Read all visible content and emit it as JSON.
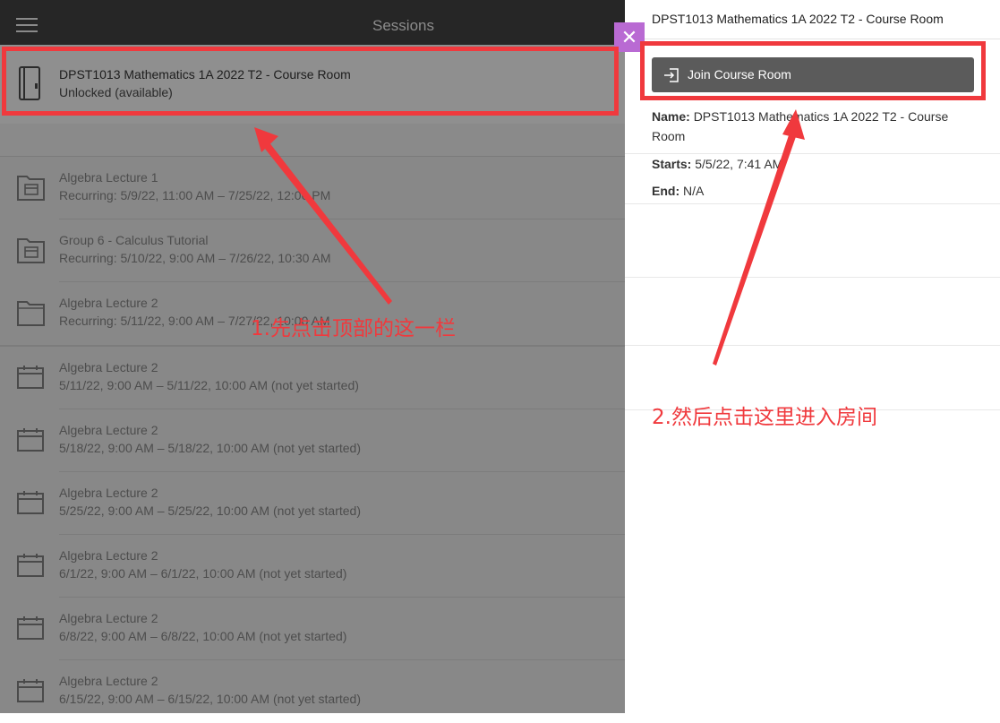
{
  "header": {
    "title": "Sessions"
  },
  "course_room": {
    "title": "DPST1013 Mathematics 1A 2022 T2 - Course Room",
    "status": "Unlocked (available)"
  },
  "recurring_sessions": [
    {
      "title": "Algebra Lecture 1",
      "time": "Recurring: 5/9/22, 11:00 AM – 7/25/22, 12:00 PM"
    },
    {
      "title": "Group 6 - Calculus Tutorial",
      "time": "Recurring: 5/10/22, 9:00 AM – 7/26/22, 10:30 AM"
    },
    {
      "title": "Algebra Lecture 2",
      "time": "Recurring: 5/11/22, 9:00 AM – 7/27/22, 10:00 AM"
    }
  ],
  "sessions": [
    {
      "title": "Algebra Lecture 2",
      "time": "5/11/22, 9:00 AM – 5/11/22, 10:00 AM (not yet started)"
    },
    {
      "title": "Algebra Lecture 2",
      "time": "5/18/22, 9:00 AM – 5/18/22, 10:00 AM (not yet started)"
    },
    {
      "title": "Algebra Lecture 2",
      "time": "5/25/22, 9:00 AM – 5/25/22, 10:00 AM (not yet started)"
    },
    {
      "title": "Algebra Lecture 2",
      "time": "6/1/22, 9:00 AM – 6/1/22, 10:00 AM (not yet started)"
    },
    {
      "title": "Algebra Lecture 2",
      "time": "6/8/22, 9:00 AM – 6/8/22, 10:00 AM (not yet started)"
    },
    {
      "title": "Algebra Lecture 2",
      "time": "6/15/22, 9:00 AM – 6/15/22, 10:00 AM (not yet started)"
    }
  ],
  "details_panel": {
    "header": "DPST1013 Mathematics 1A 2022 T2 - Course Room",
    "join_button": "Join Course Room",
    "name_label": "Name:",
    "name_value": "DPST1013 Mathematics 1A 2022 T2 - Course Room",
    "starts_label": "Starts:",
    "starts_value": "5/5/22, 7:41 AM",
    "end_label": "End:",
    "end_value": "N/A"
  },
  "annotations": {
    "step1": "1.先点击顶部的这一栏",
    "step2": "2.然后点击这里进入房间"
  },
  "colors": {
    "annotation_red": "#f0393d",
    "close_button": "#b96ad3",
    "join_button": "#5b5b5b",
    "topbar": "#262626"
  },
  "icons": {
    "menu": "hamburger-icon",
    "course_room": "door-icon",
    "recurring": "folder-calendar-icon",
    "session": "calendar-icon",
    "close": "close-icon",
    "join": "sign-in-icon"
  }
}
